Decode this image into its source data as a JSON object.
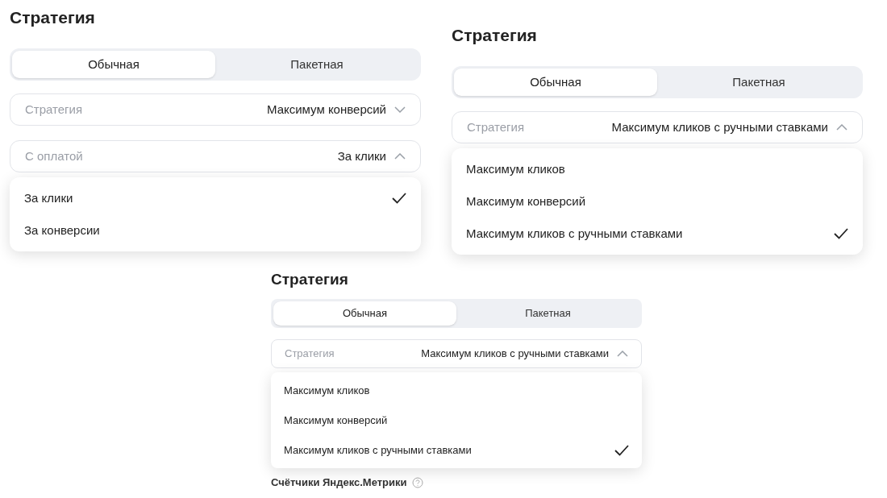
{
  "panels": [
    {
      "title": "Стратегия",
      "tabs": [
        {
          "label": "Обычная",
          "selected": true
        },
        {
          "label": "Пакетная",
          "selected": false
        }
      ],
      "fields": [
        {
          "label": "Стратегия",
          "value": "Максимум конверсий",
          "expanded": false
        },
        {
          "label": "С оплатой",
          "value": "За клики",
          "expanded": true,
          "options": [
            {
              "label": "За клики",
              "selected": true
            },
            {
              "label": "За конверсии",
              "selected": false
            }
          ]
        }
      ]
    },
    {
      "title": "Стратегия",
      "tabs": [
        {
          "label": "Обычная",
          "selected": true
        },
        {
          "label": "Пакетная",
          "selected": false
        }
      ],
      "fields": [
        {
          "label": "Стратегия",
          "value": "Максимум кликов с ручными ставками",
          "expanded": true,
          "options": [
            {
              "label": "Максимум кликов",
              "selected": false
            },
            {
              "label": "Максимум конверсий",
              "selected": false
            },
            {
              "label": "Максимум кликов с ручными ставками",
              "selected": true
            }
          ]
        }
      ]
    },
    {
      "title": "Стратегия",
      "tabs": [
        {
          "label": "Обычная",
          "selected": true
        },
        {
          "label": "Пакетная",
          "selected": false
        }
      ],
      "fields": [
        {
          "label": "Стратегия",
          "value": "Максимум кликов с ручными ставками",
          "expanded": true,
          "options": [
            {
              "label": "Максимум кликов",
              "selected": false
            },
            {
              "label": "Максимум конверсий",
              "selected": false
            },
            {
              "label": "Максимум кликов с ручными ставками",
              "selected": true
            }
          ]
        }
      ],
      "footer": "Счётчики Яндекс.Метрики"
    }
  ]
}
